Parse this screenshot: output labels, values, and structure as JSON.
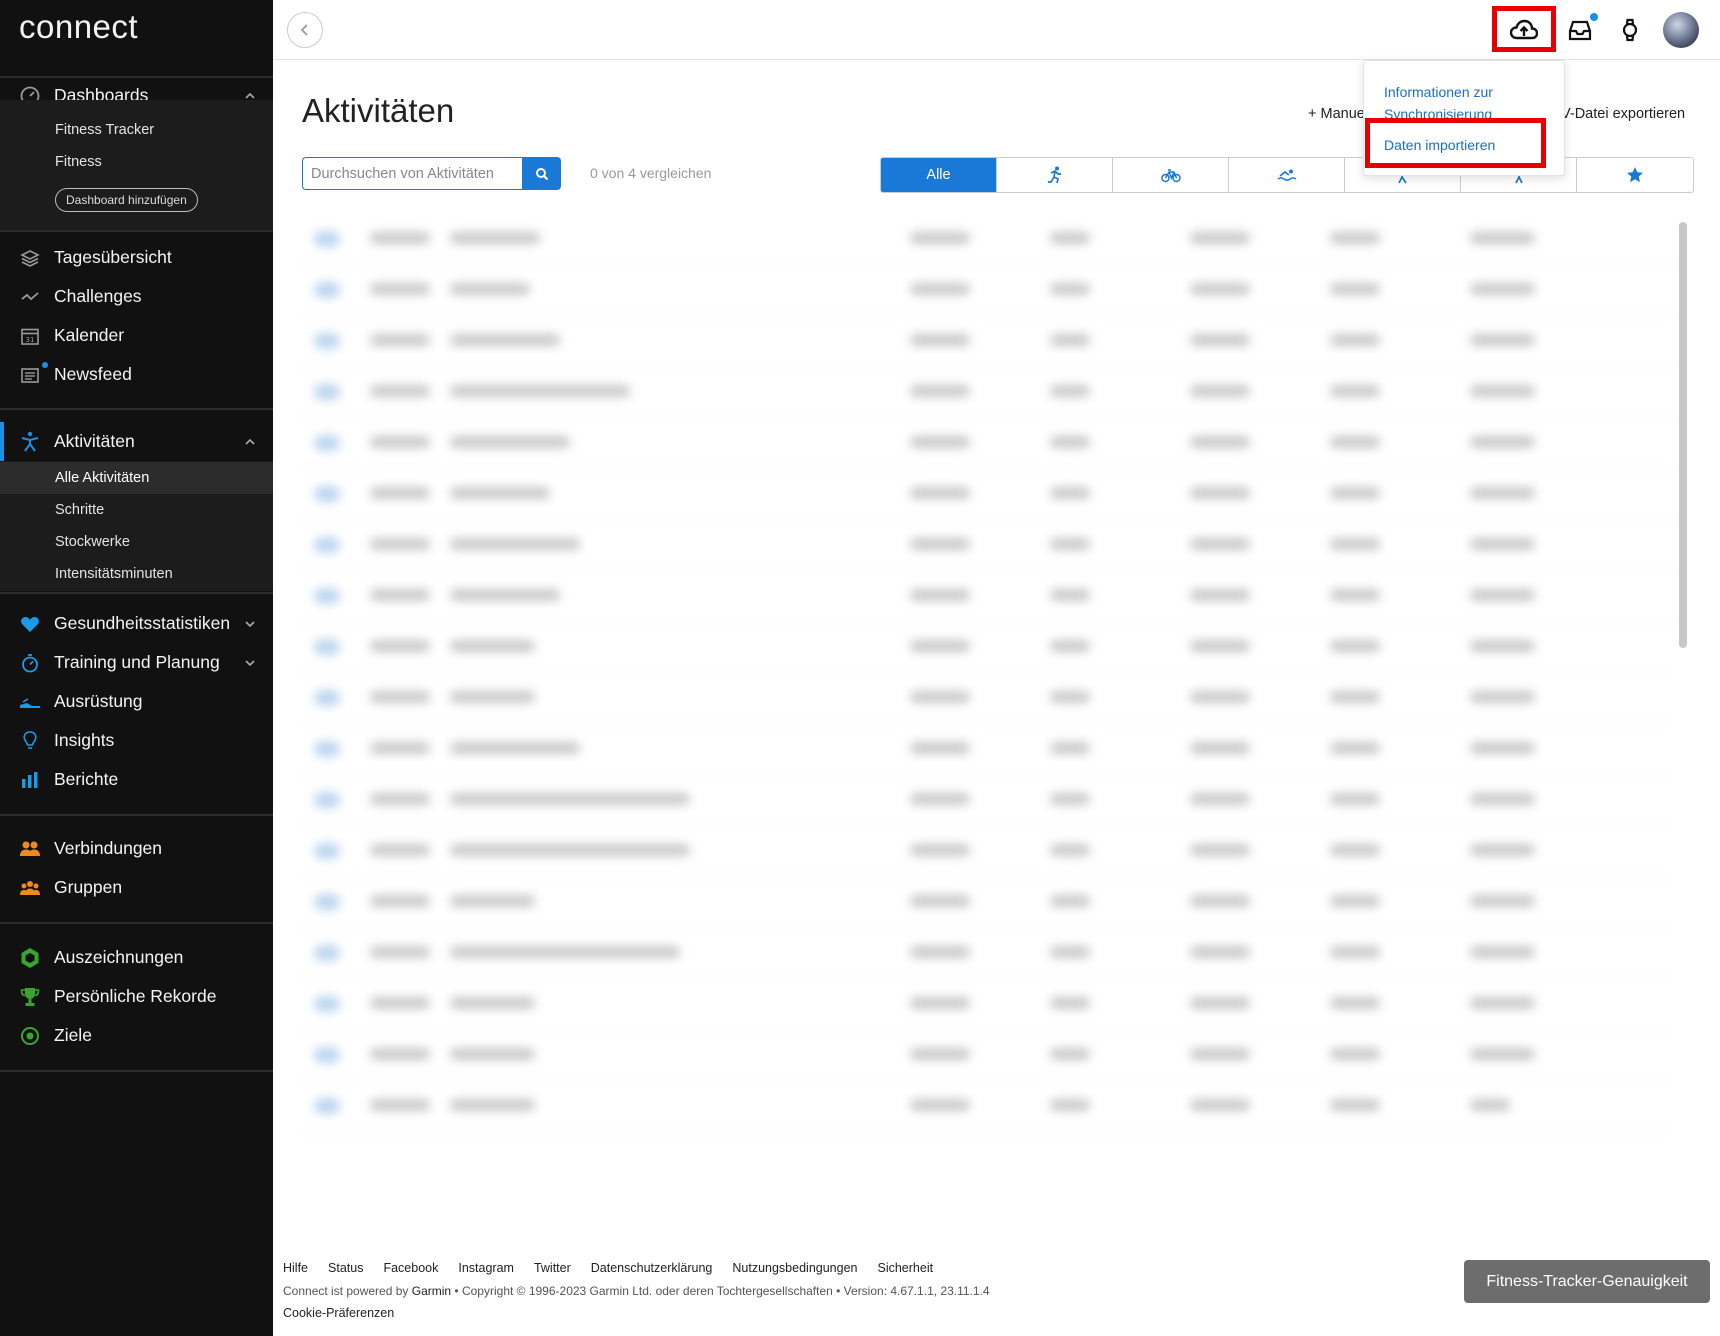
{
  "sidebar": {
    "logo": "connect",
    "dashboards": {
      "label": "Dashboards",
      "items": [
        "Fitness Tracker",
        "Fitness"
      ],
      "add_button": "Dashboard hinzufügen"
    },
    "main_items": [
      "Tagesübersicht",
      "Challenges",
      "Kalender",
      "Newsfeed"
    ],
    "activities": {
      "label": "Aktivitäten",
      "items": [
        "Alle Aktivitäten",
        "Schritte",
        "Stockwerke",
        "Intensitätsminuten"
      ]
    },
    "health_items": [
      "Gesundheitsstatistiken",
      "Training und Planung",
      "Ausrüstung",
      "Insights",
      "Berichte"
    ],
    "social_items": [
      "Verbindungen",
      "Gruppen"
    ],
    "achievement_items": [
      "Auszeichnungen",
      "Persönliche Rekorde",
      "Ziele"
    ]
  },
  "header": {
    "icons": [
      "back-icon",
      "upload-cloud-icon",
      "inbox-icon",
      "watch-icon",
      "avatar"
    ],
    "upload_dropdown": {
      "items": [
        "Informationen zur Synchronisierung",
        "Daten importieren"
      ]
    }
  },
  "main": {
    "title": "Aktivitäten",
    "manual_link": "+ Manue",
    "export_link": "V-Datei exportieren",
    "search_placeholder": "Durchsuchen von Aktivitäten",
    "compare_text": "0 von 4 vergleichen",
    "filter_all": "Alle",
    "filter_icons": [
      "running-icon",
      "cycling-icon",
      "swimming-icon",
      "hiking-icon",
      "walking-icon",
      "star-icon"
    ]
  },
  "footer": {
    "links": [
      "Hilfe",
      "Status",
      "Facebook",
      "Instagram",
      "Twitter",
      "Datenschutzerklärung",
      "Nutzungsbedingungen",
      "Sicherheit"
    ],
    "powered_prefix": "Connect ist powered by ",
    "powered_brand": "Garmin",
    "copyright": " • Copyright © 1996-2023 Garmin Ltd. oder deren Tochtergesellschaften • Version: 4.67.1.1, 23.11.1.4",
    "cookie": "Cookie-Präferenzen",
    "tracker_button": "Fitness-Tracker-Genauigkeit"
  },
  "colors": {
    "accent": "#1a78d6",
    "highlight": "#e60000",
    "sidebar_bg": "#111111"
  }
}
